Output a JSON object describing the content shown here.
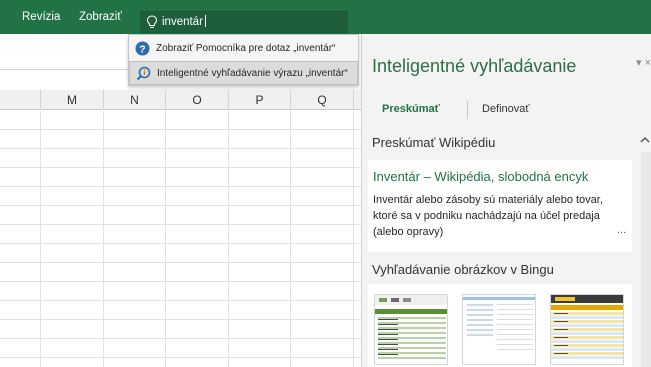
{
  "ribbon": {
    "tabs": [
      {
        "label": "Revízia"
      },
      {
        "label": "Zobraziť"
      }
    ],
    "tell_me": {
      "icon": "lightbulb-icon",
      "value": "inventár"
    },
    "color": "#217346"
  },
  "dropdown": {
    "items": [
      {
        "label": "Zobraziť Pomocníka pre dotaz „inventár“",
        "icon": "help-question-icon"
      },
      {
        "label": "Inteligentné vyhľadávanie výrazu „inventár“",
        "icon": "smart-lookup-icon",
        "selected": true
      }
    ]
  },
  "grid": {
    "columns": [
      "M",
      "N",
      "O",
      "P",
      "Q"
    ]
  },
  "pane": {
    "title": "Inteligentné vyhľadávanie",
    "tabs": [
      {
        "label": "Preskúmať",
        "active": true
      },
      {
        "label": "Definovať",
        "active": false
      }
    ],
    "wiki_heading": "Preskúmať Wikipédiu",
    "wiki_card": {
      "title": "Inventár – Wikipédia, slobodná encyk",
      "text": "Inventár alebo zásoby sú materiály alebo tovar, ktoré sa v podniku nachádzajú na účel predaja (alebo opravy)",
      "more": "..."
    },
    "bing_heading": "Vyhľadávanie obrázkov v Bingu",
    "accent": "#217346"
  }
}
